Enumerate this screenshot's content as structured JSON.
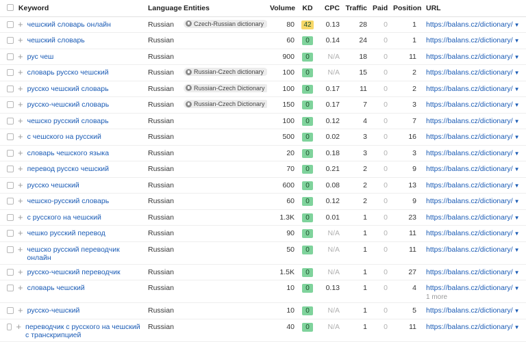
{
  "columns": {
    "keyword": "Keyword",
    "language": "Language",
    "entities": "Entities",
    "volume": "Volume",
    "kd": "KD",
    "cpc": "CPC",
    "traffic": "Traffic",
    "paid": "Paid",
    "position": "Position",
    "url": "URL"
  },
  "colors": {
    "kd_easy": "#7fd39c",
    "kd_medium": "#f7d868",
    "link": "#1a5bb5"
  },
  "rows": [
    {
      "keyword": "чешский словарь онлайн",
      "language": "Russian",
      "entity": "Czech-Russian dictionary",
      "volume": "80",
      "kd": "42",
      "kd_level": "medium",
      "cpc": "0.13",
      "traffic": "28",
      "paid": "0",
      "position": "1",
      "url": "https://balans.cz/dictionary/"
    },
    {
      "keyword": "чешский словарь",
      "language": "Russian",
      "entity": "",
      "volume": "60",
      "kd": "0",
      "kd_level": "easy",
      "cpc": "0.14",
      "traffic": "24",
      "paid": "0",
      "position": "1",
      "url": "https://balans.cz/dictionary/"
    },
    {
      "keyword": "рус чеш",
      "language": "Russian",
      "entity": "",
      "volume": "900",
      "kd": "0",
      "kd_level": "easy",
      "cpc": "N/A",
      "traffic": "18",
      "paid": "0",
      "position": "11",
      "url": "https://balans.cz/dictionary/"
    },
    {
      "keyword": "словарь русско чешский",
      "language": "Russian",
      "entity": "Russian-Czech dictionary",
      "volume": "100",
      "kd": "0",
      "kd_level": "easy",
      "cpc": "N/A",
      "traffic": "15",
      "paid": "0",
      "position": "2",
      "url": "https://balans.cz/dictionary/"
    },
    {
      "keyword": "русско чешский словарь",
      "language": "Russian",
      "entity": "Russian-Czech Dictionary",
      "volume": "100",
      "kd": "0",
      "kd_level": "easy",
      "cpc": "0.17",
      "traffic": "11",
      "paid": "0",
      "position": "2",
      "url": "https://balans.cz/dictionary/"
    },
    {
      "keyword": "русско-чешский словарь",
      "language": "Russian",
      "entity": "Russian-Czech Dictionary",
      "volume": "150",
      "kd": "0",
      "kd_level": "easy",
      "cpc": "0.17",
      "traffic": "7",
      "paid": "0",
      "position": "3",
      "url": "https://balans.cz/dictionary/"
    },
    {
      "keyword": "чешско русский словарь",
      "language": "Russian",
      "entity": "",
      "volume": "100",
      "kd": "0",
      "kd_level": "easy",
      "cpc": "0.12",
      "traffic": "4",
      "paid": "0",
      "position": "7",
      "url": "https://balans.cz/dictionary/"
    },
    {
      "keyword": "с чешского на русский",
      "language": "Russian",
      "entity": "",
      "volume": "500",
      "kd": "0",
      "kd_level": "easy",
      "cpc": "0.02",
      "traffic": "3",
      "paid": "0",
      "position": "16",
      "url": "https://balans.cz/dictionary/"
    },
    {
      "keyword": "словарь чешского языка",
      "language": "Russian",
      "entity": "",
      "volume": "20",
      "kd": "0",
      "kd_level": "easy",
      "cpc": "0.18",
      "traffic": "3",
      "paid": "0",
      "position": "3",
      "url": "https://balans.cz/dictionary/"
    },
    {
      "keyword": "перевод русско чешский",
      "language": "Russian",
      "entity": "",
      "volume": "70",
      "kd": "0",
      "kd_level": "easy",
      "cpc": "0.21",
      "traffic": "2",
      "paid": "0",
      "position": "9",
      "url": "https://balans.cz/dictionary/"
    },
    {
      "keyword": "русско чешский",
      "language": "Russian",
      "entity": "",
      "volume": "600",
      "kd": "0",
      "kd_level": "easy",
      "cpc": "0.08",
      "traffic": "2",
      "paid": "0",
      "position": "13",
      "url": "https://balans.cz/dictionary/"
    },
    {
      "keyword": "чешско-русский словарь",
      "language": "Russian",
      "entity": "",
      "volume": "60",
      "kd": "0",
      "kd_level": "easy",
      "cpc": "0.12",
      "traffic": "2",
      "paid": "0",
      "position": "9",
      "url": "https://balans.cz/dictionary/"
    },
    {
      "keyword": "с русского на чешский",
      "language": "Russian",
      "entity": "",
      "volume": "1.3K",
      "kd": "0",
      "kd_level": "easy",
      "cpc": "0.01",
      "traffic": "1",
      "paid": "0",
      "position": "23",
      "url": "https://balans.cz/dictionary/"
    },
    {
      "keyword": "чешко русский перевод",
      "language": "Russian",
      "entity": "",
      "volume": "90",
      "kd": "0",
      "kd_level": "easy",
      "cpc": "N/A",
      "traffic": "1",
      "paid": "0",
      "position": "11",
      "url": "https://balans.cz/dictionary/"
    },
    {
      "keyword": "чешско русский переводчик онлайн",
      "language": "Russian",
      "entity": "",
      "volume": "50",
      "kd": "0",
      "kd_level": "easy",
      "cpc": "N/A",
      "traffic": "1",
      "paid": "0",
      "position": "11",
      "url": "https://balans.cz/dictionary/",
      "tall": true
    },
    {
      "keyword": "русско-чешский переводчик",
      "language": "Russian",
      "entity": "",
      "volume": "1.5K",
      "kd": "0",
      "kd_level": "easy",
      "cpc": "N/A",
      "traffic": "1",
      "paid": "0",
      "position": "27",
      "url": "https://balans.cz/dictionary/"
    },
    {
      "keyword": "словарь чешский",
      "language": "Russian",
      "entity": "",
      "volume": "10",
      "kd": "0",
      "kd_level": "easy",
      "cpc": "0.13",
      "traffic": "1",
      "paid": "0",
      "position": "4",
      "url": "https://balans.cz/dictionary/",
      "more": "1 more",
      "tall": true
    },
    {
      "keyword": "русско-чешский",
      "language": "Russian",
      "entity": "",
      "volume": "10",
      "kd": "0",
      "kd_level": "easy",
      "cpc": "N/A",
      "traffic": "1",
      "paid": "0",
      "position": "5",
      "url": "https://balans.cz/dictionary/"
    },
    {
      "keyword": "переводчик с русского на чешский с транскрипцией",
      "language": "Russian",
      "entity": "",
      "volume": "40",
      "kd": "0",
      "kd_level": "easy",
      "cpc": "N/A",
      "traffic": "1",
      "paid": "0",
      "position": "11",
      "url": "https://balans.cz/dictionary/",
      "tall": true
    }
  ]
}
